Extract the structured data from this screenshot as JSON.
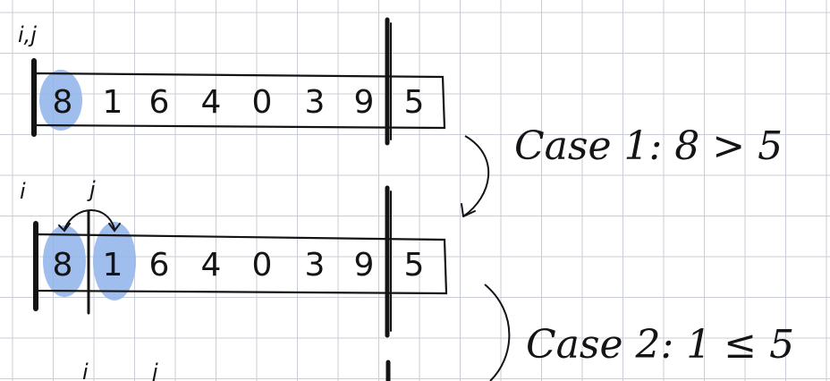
{
  "colors": {
    "grid": "#c9cdd8",
    "ink": "#141414",
    "highlight": "#8fb3ea"
  },
  "arrays": [
    {
      "values": [
        "8",
        "1",
        "6",
        "4",
        "0",
        "3",
        "9",
        "5"
      ],
      "pointer_label": "i,j",
      "highlighted": [
        0
      ]
    },
    {
      "values": [
        "8",
        "1",
        "6",
        "4",
        "0",
        "3",
        "9",
        "5"
      ],
      "i_label": "i",
      "j_label": "j",
      "highlighted": [
        0,
        1
      ]
    }
  ],
  "bottom_labels": {
    "i": "i",
    "j": "j"
  },
  "cases": [
    {
      "text": "Case 1: 8 > 5"
    },
    {
      "text": "Case 2: 1 ≤ 5"
    }
  ]
}
